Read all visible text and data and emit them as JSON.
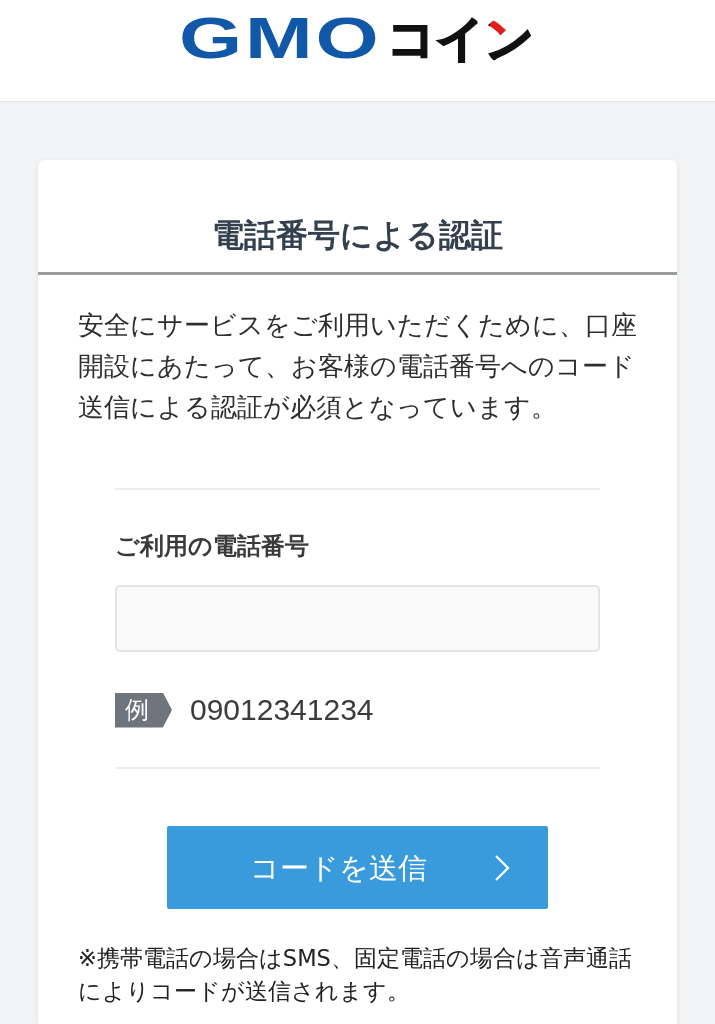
{
  "header": {
    "logo": {
      "brand": "GMO",
      "name": "コイン"
    }
  },
  "card": {
    "title": "電話番号による認証",
    "description": "安全にサービスをご利用いただくために、口座開設にあたって、お客様の電話番号へのコード送信による認証が必須となっています。",
    "phone_field": {
      "label": "ご利用の電話番号",
      "example_tag": "例",
      "example": "09012341234"
    },
    "submit_button": "コードを送信",
    "note": "※携帯電話の場合はSMS、固定電話の場合は音声通話によりコードが送信されます。"
  }
}
